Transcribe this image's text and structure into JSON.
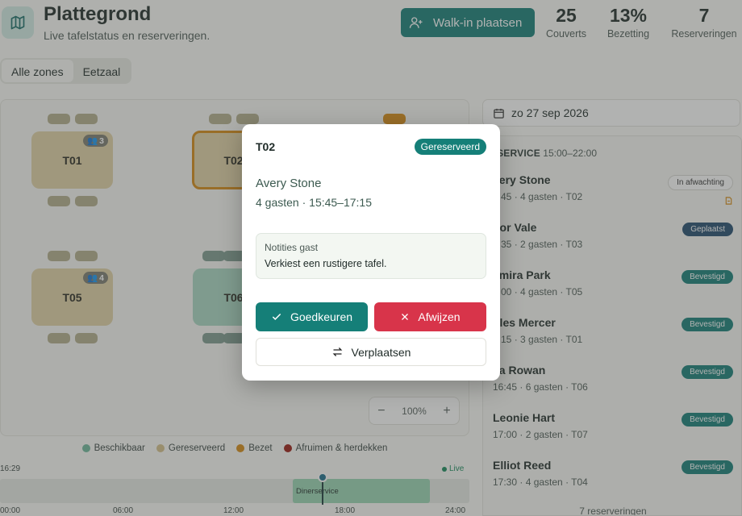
{
  "header": {
    "title": "Plattegrond",
    "subtitle": "Live tafelstatus en reserveringen.",
    "walkin_label": "Walk-in plaatsen",
    "stats": [
      {
        "value": "25",
        "label": "Couverts"
      },
      {
        "value": "13%",
        "label": "Bezetting"
      },
      {
        "value": "7",
        "label": "Reserveringen"
      }
    ]
  },
  "zones": [
    "Alle zones",
    "Eetzaal"
  ],
  "active_zone": "Alle zones",
  "tables": [
    {
      "id": "T01",
      "status": "reserved",
      "capacity": "3"
    },
    {
      "id": "T02",
      "status": "occupied",
      "capacity": ""
    },
    {
      "id": "T05",
      "status": "reserved",
      "capacity": "4"
    },
    {
      "id": "T06",
      "status": "available",
      "capacity": ""
    }
  ],
  "zoom": {
    "level": "100%",
    "minus": "−",
    "plus": "+"
  },
  "legend": [
    {
      "label": "Beschikbaar",
      "color": "#6fb89b"
    },
    {
      "label": "Gereserveerd",
      "color": "#d6c28a"
    },
    {
      "label": "Bezet",
      "color": "#d68a13"
    },
    {
      "label": "Afruimen & herdekken",
      "color": "#9a1a12"
    }
  ],
  "timeline": {
    "now": "16:29",
    "live": "Live",
    "block": "Dinerservice",
    "ticks": [
      "00:00",
      "06:00",
      "12:00",
      "18:00",
      "24:00"
    ]
  },
  "date": "zo 27 sep 2026",
  "service": {
    "name": "ERSERVICE",
    "time": "15:00–22:00"
  },
  "reservations": [
    {
      "name": "very Stone",
      "meta": "5:45  ·  4 gasten  ·  T02",
      "badge": "In afwachting",
      "kind": "wacht",
      "note": true
    },
    {
      "name": "oor Vale",
      "meta": "5:35  ·  2 gasten  ·  T03",
      "badge": "Geplaatst",
      "kind": "geplaatst",
      "note": false
    },
    {
      "name": "amira Park",
      "meta": "6:00  ·  4 gasten  ·  T05",
      "badge": "Bevestigd",
      "kind": "bevestigd",
      "note": false
    },
    {
      "name": "ules Mercer",
      "meta": "6:15  ·  3 gasten  ·  T01",
      "badge": "Bevestigd",
      "kind": "bevestigd",
      "note": false
    },
    {
      "name": "ila Rowan",
      "meta": "16:45  ·  6 gasten  ·  T06",
      "badge": "Bevestigd",
      "kind": "bevestigd",
      "note": false
    },
    {
      "name": "Leonie Hart",
      "meta": "17:00  ·  2 gasten  ·  T07",
      "badge": "Bevestigd",
      "kind": "bevestigd",
      "note": false
    },
    {
      "name": "Elliot Reed",
      "meta": "17:30  ·  4 gasten  ·  T04",
      "badge": "Bevestigd",
      "kind": "bevestigd",
      "note": false
    }
  ],
  "res_footer": "7 reserveringen",
  "modal": {
    "table": "T02",
    "status": "Gereserveerd",
    "guest": "Avery Stone",
    "meta": "4 gasten · 15:45–17:15",
    "notes_label": "Notities gast",
    "notes_text": "Verkiest een rustigere tafel.",
    "approve": "Goedkeuren",
    "reject": "Afwijzen",
    "move": "Verplaatsen"
  }
}
